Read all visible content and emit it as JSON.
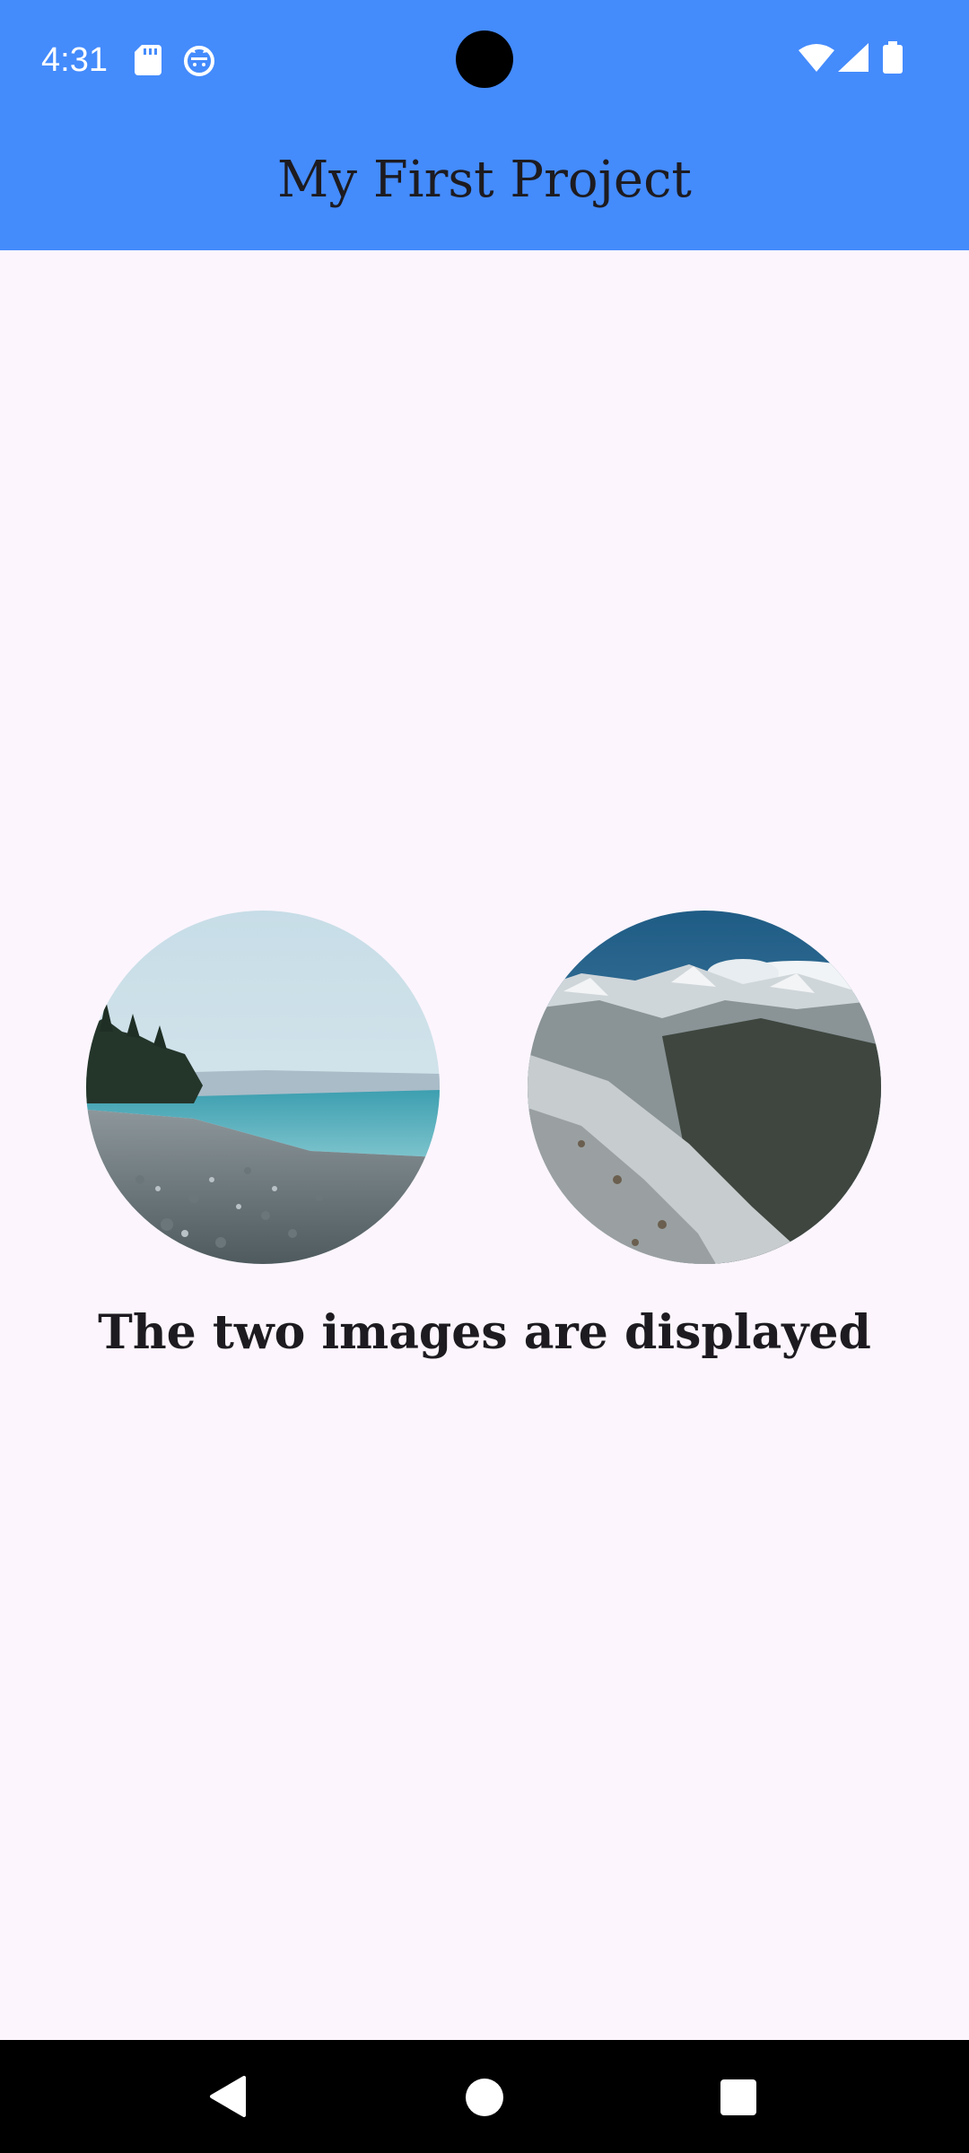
{
  "status_bar": {
    "time": "4:31",
    "icons": [
      "sd-card-icon",
      "cat-face-icon",
      "wifi-icon",
      "cell-signal-icon",
      "battery-icon"
    ],
    "color": "#448bfc"
  },
  "app_bar": {
    "title": "My First Project",
    "color": "#448bfc"
  },
  "main": {
    "images": [
      {
        "name": "beach-image",
        "subject": "pebble beach shoreline with blue sea"
      },
      {
        "name": "mountain-image",
        "subject": "snowy mountain valley"
      }
    ],
    "caption": "The two images are displayed"
  },
  "nav_bar": {
    "buttons": [
      "back-icon",
      "home-icon",
      "recents-icon"
    ]
  },
  "colors": {
    "background": "#fcf5fd",
    "text": "#1d1b20"
  }
}
